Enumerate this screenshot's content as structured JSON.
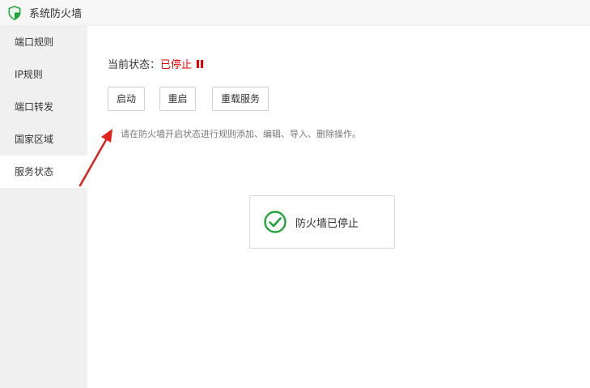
{
  "app": {
    "title": "系统防火墙",
    "icon": "shield-icon"
  },
  "sidebar": {
    "items": [
      {
        "label": "端口规则",
        "active": false
      },
      {
        "label": "IP规则",
        "active": false
      },
      {
        "label": "端口转发",
        "active": false
      },
      {
        "label": "国家区域",
        "active": false
      },
      {
        "label": "服务状态",
        "active": true
      }
    ]
  },
  "main": {
    "status_label": "当前状态：",
    "status_value": "已停止",
    "status_icon": "pause-icon",
    "buttons": {
      "start": "启动",
      "restart": "重启",
      "reload": "重载服务"
    },
    "hint": "请在防火墙开启状态进行规则添加、编辑、导入、删除操作。",
    "annotation_icon": "red-arrow-icon"
  },
  "toast": {
    "message": "防火墙已停止",
    "icon": "check-circle-icon"
  },
  "colors": {
    "stopped": "#e60000",
    "success": "#20a53a",
    "arrow": "#e0201a"
  }
}
